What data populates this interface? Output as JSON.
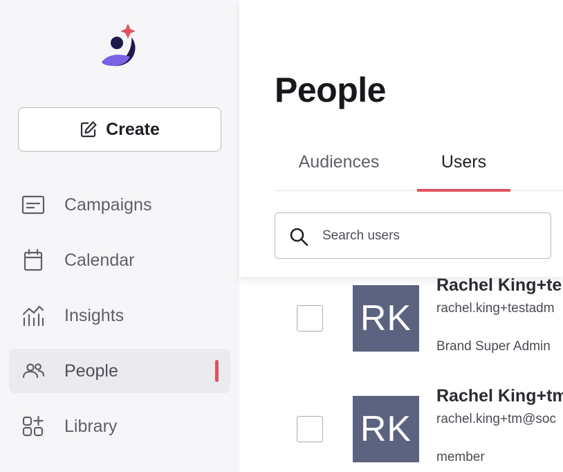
{
  "sidebar": {
    "create_label": "Create",
    "items": [
      {
        "label": "Campaigns",
        "icon": "campaigns-icon",
        "active": false
      },
      {
        "label": "Calendar",
        "icon": "calendar-icon",
        "active": false
      },
      {
        "label": "Insights",
        "icon": "insights-icon",
        "active": false
      },
      {
        "label": "People",
        "icon": "people-icon",
        "active": true
      },
      {
        "label": "Library",
        "icon": "library-icon",
        "active": false
      }
    ]
  },
  "main": {
    "title": "People",
    "tabs": [
      {
        "label": "Audiences",
        "active": false
      },
      {
        "label": "Users",
        "active": true
      }
    ],
    "search": {
      "placeholder": "Search users",
      "value": ""
    },
    "users": [
      {
        "initials": "RK",
        "name": "Rachel King+te",
        "email": "rachel.king+testadm",
        "role": "Brand Super Admin"
      },
      {
        "initials": "RK",
        "name": "Rachel King+tm",
        "email": "rachel.king+tm@soc",
        "role": "member"
      }
    ]
  },
  "colors": {
    "accent": "#e0525d",
    "logo_purple": "#7b61e6",
    "logo_navy": "#1e1b4b",
    "avatar_bg": "#5b6380",
    "sidebar_bg": "#f6f6f8"
  }
}
